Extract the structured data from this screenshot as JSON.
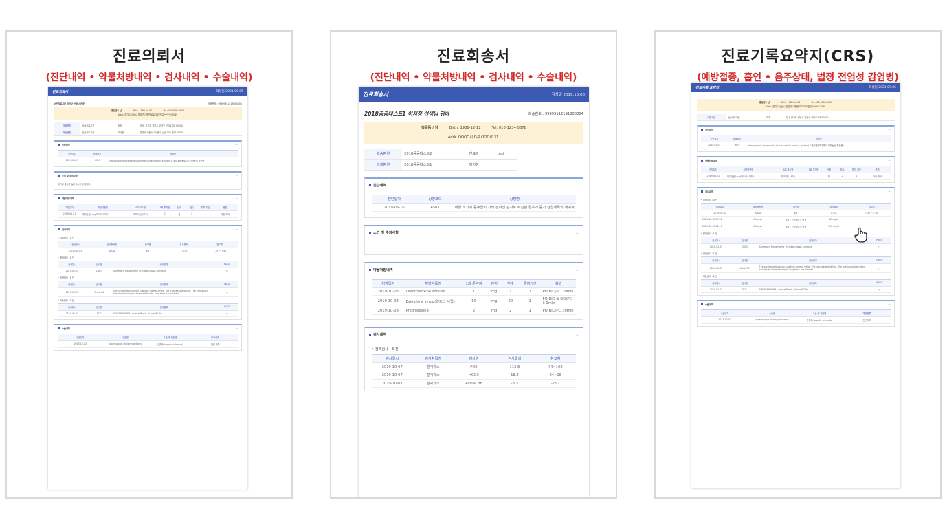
{
  "panels": [
    {
      "title": "진료의뢰서",
      "subtitle": "(진단내역 • 약물처방내역 • 검사내역 • 수술내역)",
      "doc": {
        "header_title": "진료의뢰서",
        "header_date": "작성일 2021.09.05",
        "institution": "수진의료기관 강의사 선생님 귀하",
        "id_label": "의뢰번호 : 99999912109000001",
        "patient_name": "홍길동 / 남",
        "birth": "Birth. 1980-04-01",
        "tel": "Tel. 010-0000-0000",
        "address": "Addr. 경기도 성남시 분당구 대왕판교로 545번길 ***** 13549",
        "ref_rows": [
          [
            "의뢰병원",
            "슬슬의료기관",
            "외과",
            "의사: 강기도 성남시 분당구 구미로 35 00000"
          ],
          [
            "회송병원",
            "슬슬의료기관",
            "의사명",
            "강의사 서울시 서대문구 상호 000 번지 00000"
          ]
        ],
        "sections": {
          "diag_title": "진단내역",
          "diag_headers": [
            "진단일자",
            "상병코드",
            "상병명"
          ],
          "diag_rows": [
            [
              "2019-02-01",
              "I670",
              "Nonpyogenic thrombosis of intracranial venous system(두개강내정맥계통의 비화농성 혈전증)"
            ]
          ],
          "note_title": "소견 및 주의사항",
          "note_text": "위가로 통사를 실거두시기 바랍니다.",
          "rx_title": "약물처방내역",
          "rx_headers": [
            "처방일자",
            "처방약품명",
            "ATC코드명",
            "1회 투약량",
            "단위",
            "횟수",
            "투약 기간",
            "용법"
          ],
          "rx_rows": [
            [
              "2019-04-21",
              "페리돈정1mg(파오리스미트)",
              "파모티딘 (ATC)",
              "1",
              "정",
              "2",
              "1",
              "아침·저녁"
            ]
          ],
          "exam_title": "검사내역",
          "exam_groups": [
            {
              "label": "• 검체검사 : 1 건",
              "headers": [
                "검사일시",
                "검사항목명",
                "검사명",
                "검사결과",
                "참고치"
              ],
              "rows": [
                [
                  "2019-10-03",
                  "ABGA",
                  "pH",
                  "7.374",
                  "7.35 ~ 7.45"
                ]
              ]
            },
            {
              "label": "• 병리검사 : 1 건",
              "headers": [
                "검사일시",
                "검사명",
                "검사결과",
                "PACS"
              ],
              "rows": [
                [
                  "2019-02-05",
                  "CBSG",
                  "Summary: Negative for M. tuberculosis complex",
                  "○"
                ]
              ]
            },
            {
              "label": "• 영상검사 : 1 건",
              "headers": [
                "검사일시",
                "검사명",
                "검사결과",
                "PACS"
              ],
              "rows": [
                [
                  "2019-02-05",
                  "Chest PA",
                  "The cardiomediastinum is within normal limits. The trachea is mid line. The previously described opacity at the medial right lung base has cleared.",
                  "○"
                ]
              ]
            },
            {
              "label": "• 기능검사 : 1 건",
              "headers": [
                "검사일시",
                "검사명",
                "검사결과",
                "PACS"
              ],
              "rows": [
                [
                  "2019-02-05",
                  "ECG",
                  "SINUS RHYTHM : normal P axis, V-rate 50-99",
                  "○"
                ]
              ]
            }
          ],
          "surg_title": "수술내역",
          "surg_headers": [
            "수술일자",
            "수술명",
            "수술 후 진단명",
            "마취종류"
          ],
          "surg_rows": [
            [
              "2013-10-02",
              "laparoscopic cholecystectomy",
              "간경화(hepatic sclerosis)",
              "전신 마취"
            ]
          ]
        }
      }
    },
    {
      "title": "진료회송서",
      "subtitle": "(진단내역 • 약물처방내역 • 검사내역 • 수술내역)",
      "doc": {
        "header_title": "진료회송서",
        "header_date": "작성일 2019.10.08",
        "institution": "2018공공테스트1 이지정 선생님 귀하",
        "id_label": "회송번호 : 99995112191000004",
        "patient_name": "홍길동 / 남",
        "birth": "Birth. 1988-12-12",
        "tel": "Tel. 010-1234-5678",
        "address": "Addr. OOOO시 O구 OOO로 31.",
        "ref_rows": [
          [
            "회송병원",
            "2018공공테스트2",
            "진료과",
            "test"
          ],
          [
            "의뢰병원",
            "2018공공테스트1",
            "이지정",
            ""
          ]
        ],
        "sections": {
          "diag_title": "진단내역",
          "diag_headers": [
            "진단일자",
            "상병코드",
            "상병명"
          ],
          "diag_rows": [
            [
              "2019-06-16",
              "A501",
              "태양 조기에 증후없이 가려 장미진 검사로 확진된 경우가 증가 선천매독의 재귀적"
            ]
          ],
          "note_title": "소견 및 주의사항",
          "rx_title": "약물처방내역",
          "rx_headers": [
            "처방일자",
            "처방약품명",
            "1회 투약량",
            "단위",
            "횟수",
            "투여기간",
            "용법"
          ],
          "rx_rows": [
            [
              "2019-10-08",
              "Levothyroxine sodium",
              "1",
              "mg",
              "1",
              "1",
              "PO(BID)PC 30min"
            ],
            [
              "2019-10-08",
              "Eviolotine syrup(알도스 시럽)",
              "10",
              "mg",
              "20",
              "1",
              "PO(BID & OD)PC 3 0min"
            ],
            [
              "2019-10-08",
              "Prednisolone",
              "2",
              "mg",
              "2",
              "1",
              "PO(BID)PC 30min"
            ]
          ],
          "exam_title": "검사내역",
          "exam_label": "• 검체검사 : 3 건",
          "exam_headers": [
            "검사일시",
            "검사항목명",
            "검사명",
            "검사결과",
            "참고치"
          ],
          "exam_rows": [
            [
              "2019-10-07",
              "혈액가스",
              "PO2",
              "113.8",
              "74~108"
            ],
            [
              "2019-10-07",
              "혈액가스",
              "HCO3",
              "18.8",
              "24~28"
            ],
            [
              "2019-10-07",
              "혈액가스",
              "Actual BE",
              "-8.3",
              "-2~2"
            ]
          ]
        }
      }
    },
    {
      "title": "진료기록요약지(CRS)",
      "subtitle": "(예방접종, 흡연 • 음주상태, 법정 전염성 감염병)",
      "doc": {
        "header_title": "진료기록 요약지",
        "header_date": "작성일 2021.09.05",
        "patient_name": "홍길동 / 남",
        "birth": "Birth. 1980-04-01",
        "tel": "Tel. 010-0000-0000",
        "address": "Addr. 경기도 성남시 분당구 대왕판교로 545번길 ***** 13549",
        "ref_rows": [
          [
            "요청기관",
            "슬슬의료기관",
            "외과",
            "의사: 강기도 성남시 분당구 구미로 35 00000"
          ]
        ],
        "sections": {
          "diag_title": "진단내역",
          "diag_headers": [
            "진단일자",
            "상병코드",
            "상병명"
          ],
          "diag_rows": [
            [
              "2019-02-01",
              "I670",
              "Nonpyogenic thrombosis of intracranial venous system(두개강내정맥계통의 비화농성 혈전증)"
            ]
          ],
          "rx_title": "약물처방내역",
          "rx_headers": [
            "처방일자",
            "처방약품명",
            "ATC코드명",
            "1회 투약량",
            "단위",
            "횟수",
            "투약 기간",
            "용법"
          ],
          "rx_rows": [
            [
              "2019-04-21",
              "페리돈정1mg(파오리스미트)",
              "파모티딘 (ATC)",
              "1",
              "정",
              "2",
              "1",
              "아침·저녁"
            ]
          ],
          "exam_title": "검사내역",
          "exam_groups": [
            {
              "label": "• 검체검사 : 3 건",
              "headers": [
                "검사일시",
                "검사항목명",
                "검사명",
                "검사결과",
                "참고치"
              ],
              "rows": [
                [
                  "2019-02-02",
                  "ABGA",
                  "pH",
                  "7.374",
                  "7.35 ~ 7.45"
                ],
                [
                  "2021-08-30 07:52",
                  "Glucose",
                  "혈당 - 간이혈당기 측정",
                  "82 mg/dl",
                  ""
                ],
                [
                  "2021-08-30 12:10",
                  "Glucose",
                  "혈당 - 간이혈당기 측정",
                  "110 mg/dl",
                  ""
                ]
              ]
            },
            {
              "label": "• 병리검사 : 1 건",
              "headers": [
                "검사일시",
                "검사명",
                "검사결과",
                "PACS"
              ],
              "rows": [
                [
                  "2019-02-05",
                  "CBSG",
                  "Summary: Negative for M. tuberculosis complex",
                  "○"
                ]
              ]
            },
            {
              "label": "• 영상검사 : 1 건",
              "headers": [
                "검사일시",
                "검사명",
                "검사결과",
                "PACS"
              ],
              "rows": [
                [
                  "2019-02-05",
                  "Chest PA",
                  "The cardiomediastinum is within normal limits. The trachea is mid line. The previously described opacity at the medial right lung base has cleared.",
                  "○"
                ]
              ]
            },
            {
              "label": "• 기능검사 : 1 건",
              "headers": [
                "검사일시",
                "검사명",
                "검사결과",
                "PACS"
              ],
              "rows": [
                [
                  "2019-02-05",
                  "ECG",
                  "SINUS RHYTHM : normal P axis, V-rate 50-99",
                  "○"
                ]
              ]
            }
          ],
          "surg_title": "수술내역",
          "surg_headers": [
            "수술일자",
            "수술명",
            "수술 후 진단명",
            "마취종류"
          ],
          "surg_rows": [
            [
              "2013-10-02",
              "laparoscopic cholecystectomy",
              "간경화(hepatic sclerosis)",
              "전신 마취"
            ]
          ]
        }
      }
    }
  ],
  "cursor_icon": "hand-pointer-icon"
}
